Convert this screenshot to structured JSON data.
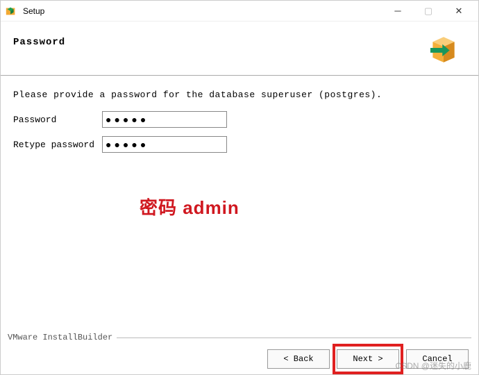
{
  "titlebar": {
    "title": "Setup"
  },
  "header": {
    "heading": "Password"
  },
  "content": {
    "instruction": "Please provide a password for the database superuser (postgres).",
    "fields": {
      "password_label": "Password",
      "password_value": "●●●●●",
      "retype_label": "Retype password",
      "retype_value": "●●●●●"
    },
    "annotation": "密码 admin"
  },
  "footer": {
    "brand": "VMware InstallBuilder",
    "buttons": {
      "back": "< Back",
      "next": "Next >",
      "cancel": "Cancel"
    }
  },
  "watermark": "CSDN @迷失的小鹿"
}
